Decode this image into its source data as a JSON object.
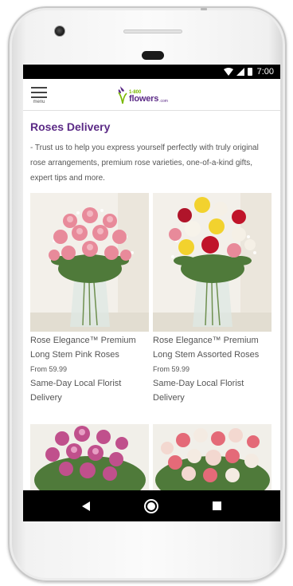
{
  "status_bar": {
    "time": "7:00"
  },
  "header": {
    "menu_label": "menu",
    "logo_number": "1-800",
    "logo_word": "flowers",
    "logo_suffix": ".com"
  },
  "page": {
    "title": "Roses Delivery",
    "intro": "- Trust us to help you express yourself perfectly with truly original rose arrangements, premium rose varieties, one-of-a-kind gifts, expert tips and more."
  },
  "products": [
    {
      "name": "Rose Elegance™ Premium Long Stem Pink Roses",
      "price": "From 59.99",
      "delivery": "Same-Day Local Florist Delivery"
    },
    {
      "name": "Rose Elegance™ Premium Long Stem Assorted Roses",
      "price": "From 59.99",
      "delivery": "Same-Day Local Florist Delivery"
    },
    {
      "name": "",
      "price": "",
      "delivery": ""
    },
    {
      "name": "",
      "price": "",
      "delivery": ""
    }
  ],
  "colors": {
    "brand_purple": "#5b2a86",
    "brand_green": "#7ab800",
    "text_gray": "#555555"
  },
  "icons": {
    "menu": "hamburger-menu-icon",
    "back": "back-triangle-icon",
    "home": "home-circle-icon",
    "recents": "recents-square-icon"
  }
}
